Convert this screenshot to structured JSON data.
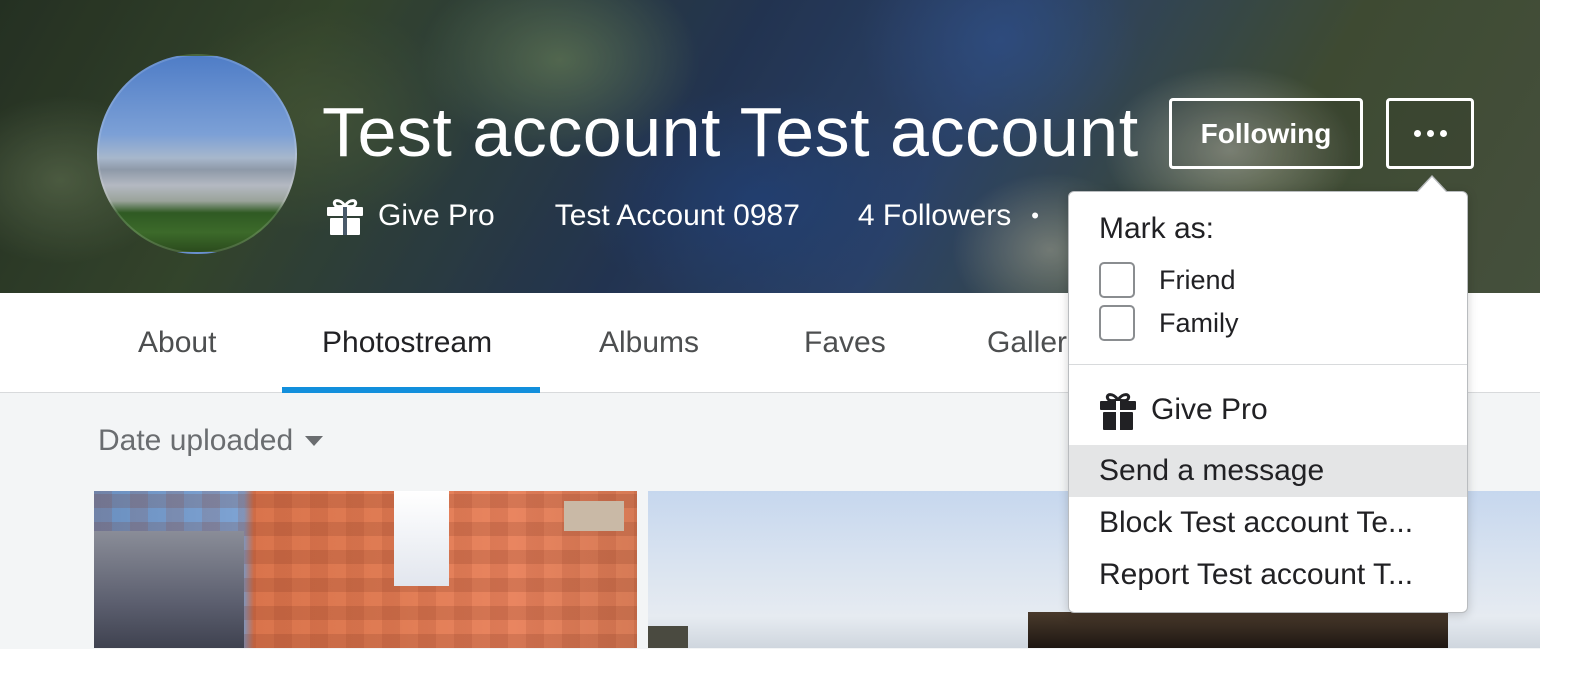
{
  "profile": {
    "name": "Test account Test account",
    "give_pro": "Give Pro",
    "username": "Test Account 0987",
    "followers": "4 Followers",
    "separator": "•"
  },
  "actions": {
    "following_label": "Following",
    "more_icon": "more-dots-icon"
  },
  "tabs": [
    {
      "label": "About",
      "active": false
    },
    {
      "label": "Photostream",
      "active": true
    },
    {
      "label": "Albums",
      "active": false
    },
    {
      "label": "Faves",
      "active": false
    },
    {
      "label": "Galler",
      "active": false
    }
  ],
  "sort": {
    "label": "Date uploaded",
    "icon": "caret-down-icon"
  },
  "menu": {
    "mark_as_title": "Mark as:",
    "checkboxes": [
      {
        "label": "Friend",
        "checked": false
      },
      {
        "label": "Family",
        "checked": false
      }
    ],
    "items": [
      {
        "label": "Give Pro",
        "icon": "gift-icon"
      },
      {
        "label": "Send a message",
        "highlighted": true
      },
      {
        "label": "Block Test account Te..."
      },
      {
        "label": "Report Test account T..."
      }
    ]
  },
  "colors": {
    "accent": "#128fdc",
    "menu_hover": "#e4e5e6",
    "content_bg": "#f3f5f6"
  }
}
